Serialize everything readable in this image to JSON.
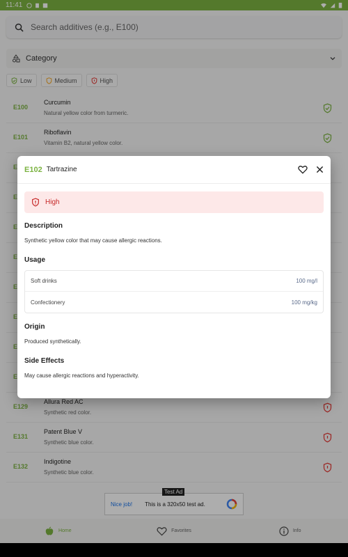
{
  "status_bar": {
    "time": "11:41"
  },
  "search": {
    "placeholder": "Search additives (e.g., E100)"
  },
  "category": {
    "label": "Category"
  },
  "filters": [
    {
      "label": "Low",
      "color": "#7cb342"
    },
    {
      "label": "Medium",
      "color": "#f5a623"
    },
    {
      "label": "High",
      "color": "#e53935"
    }
  ],
  "list": [
    {
      "code": "E100",
      "name": "Curcumin",
      "desc": "Natural yellow color from turmeric.",
      "risk": "low"
    },
    {
      "code": "E101",
      "name": "Riboflavin",
      "desc": "Vitamin B2, natural yellow color.",
      "risk": "low"
    },
    {
      "code": "E",
      "name": "",
      "desc": "",
      "risk": ""
    },
    {
      "code": "E",
      "name": "",
      "desc": "",
      "risk": ""
    },
    {
      "code": "E",
      "name": "",
      "desc": "",
      "risk": ""
    },
    {
      "code": "E",
      "name": "",
      "desc": "",
      "risk": ""
    },
    {
      "code": "E",
      "name": "",
      "desc": "",
      "risk": ""
    },
    {
      "code": "E",
      "name": "",
      "desc": "",
      "risk": ""
    },
    {
      "code": "E",
      "name": "",
      "desc": "",
      "risk": ""
    },
    {
      "code": "E",
      "name": "",
      "desc": "",
      "risk": ""
    },
    {
      "code": "E129",
      "name": "Allura Red AC",
      "desc": "Synthetic red color.",
      "risk": "high"
    },
    {
      "code": "E131",
      "name": "Patent Blue V",
      "desc": "Synthetic blue color.",
      "risk": "high"
    },
    {
      "code": "E132",
      "name": "Indigotine",
      "desc": "Synthetic blue color.",
      "risk": "high"
    }
  ],
  "ad": {
    "nice": "Nice job!",
    "text": "This is a 320x50 test ad.",
    "badge": "Test Ad"
  },
  "nav": [
    {
      "label": "Home",
      "icon": "apple-icon",
      "active": true
    },
    {
      "label": "Favorites",
      "icon": "heart-icon",
      "active": false
    },
    {
      "label": "Info",
      "icon": "info-icon",
      "active": false
    }
  ],
  "dialog": {
    "code": "E102",
    "name": "Tartrazine",
    "risk_label": "High",
    "description_title": "Description",
    "description": "Synthetic yellow color that may cause allergic reactions.",
    "usage_title": "Usage",
    "usage": [
      {
        "product": "Soft drinks",
        "amount": "100 mg/l"
      },
      {
        "product": "Confectionery",
        "amount": "100 mg/kg"
      }
    ],
    "origin_title": "Origin",
    "origin": "Produced synthetically.",
    "side_effects_title": "Side Effects",
    "side_effects": "May cause allergic reactions and hyperactivity."
  },
  "colors": {
    "brand": "#7cb342",
    "danger": "#e53935",
    "danger_bg": "#fde8e8"
  }
}
